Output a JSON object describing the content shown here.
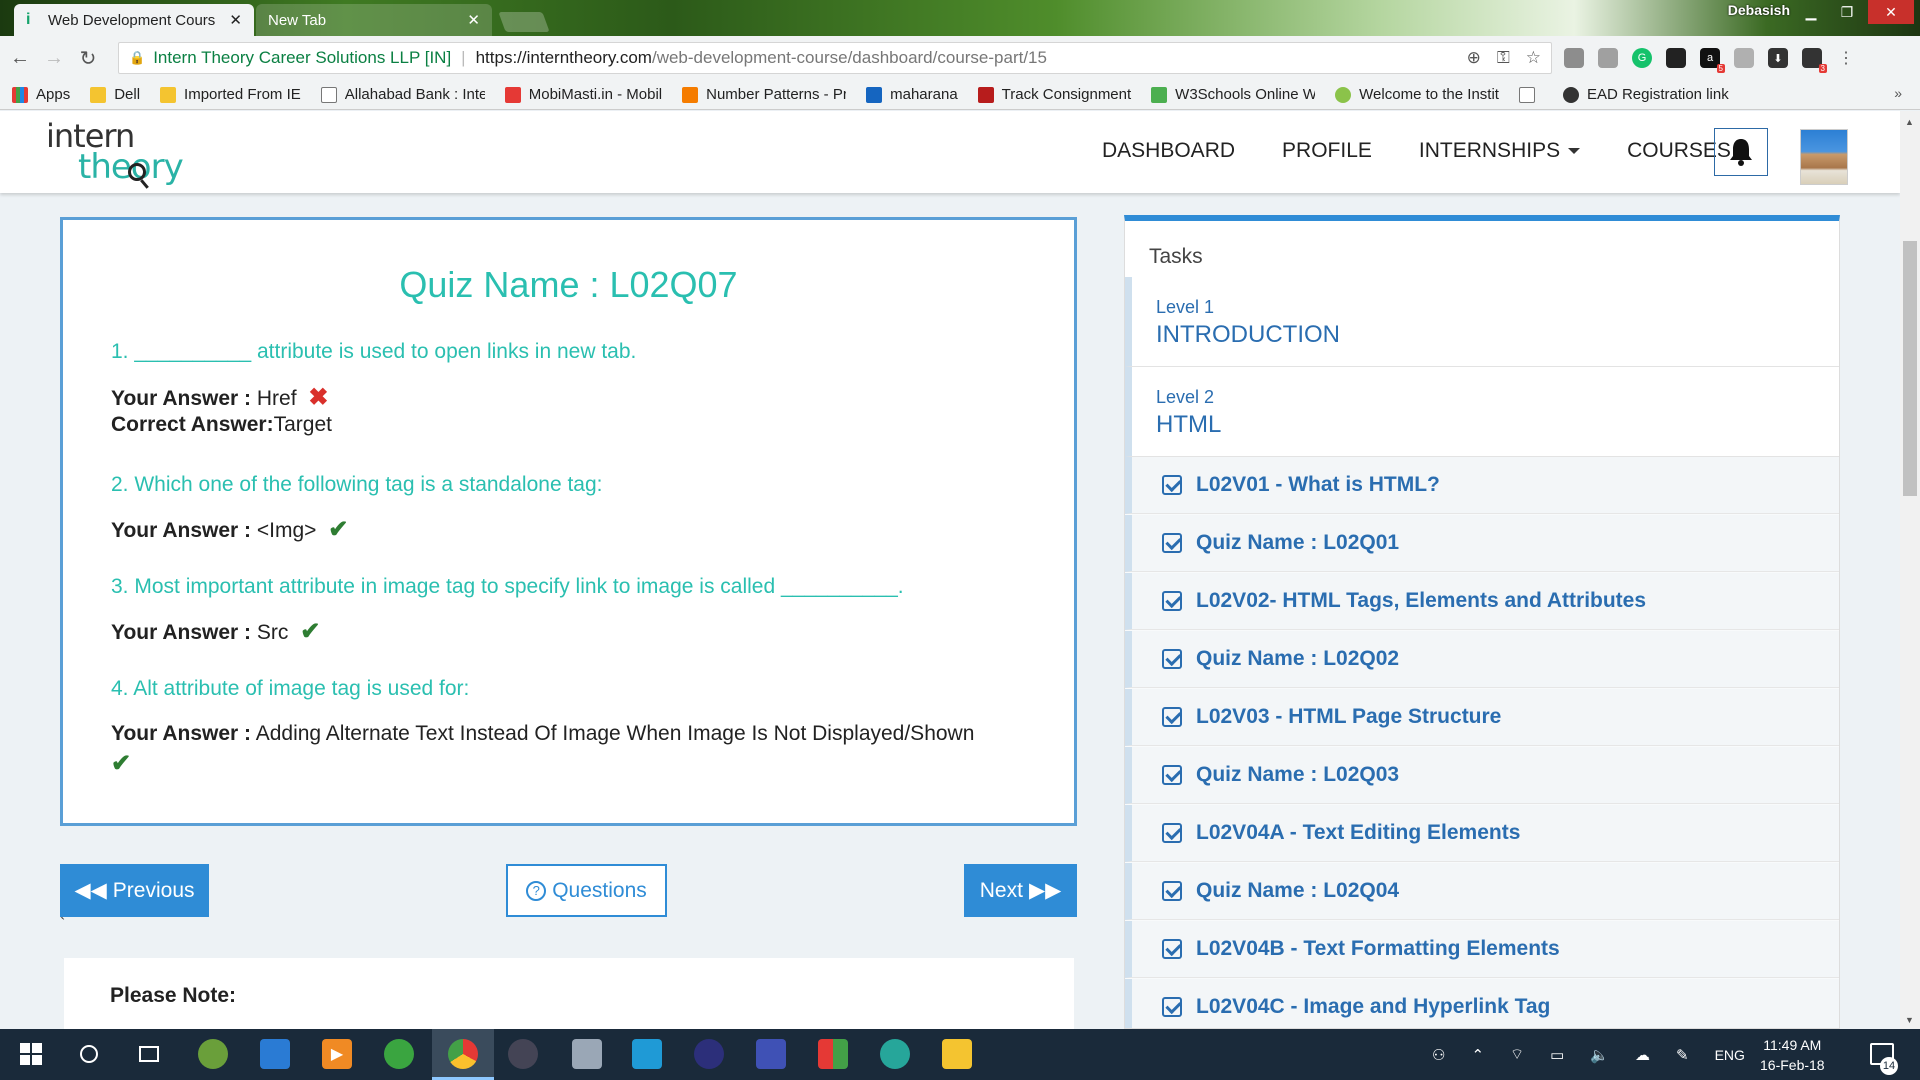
{
  "browser": {
    "tabs": [
      {
        "title": "Web Development Cours",
        "active": true
      },
      {
        "title": "New Tab",
        "active": false
      }
    ],
    "user": "Debasish",
    "site_identity": "Intern Theory Career Solutions LLP [IN]",
    "url_host": "https://interntheory.com",
    "url_path": "/web-development-course/dashboard/course-part/15",
    "extension_badges": [
      "5",
      "3"
    ],
    "bookmarks": [
      {
        "label": "Apps",
        "icon": "apps-grid-icon"
      },
      {
        "label": "Dell",
        "icon": "folder-icon"
      },
      {
        "label": "Imported From IE",
        "icon": "folder-icon"
      },
      {
        "label": "Allahabad Bank : Inte",
        "icon": "page-icon"
      },
      {
        "label": "MobiMasti.in - Mobil",
        "icon": "mobimasti-icon"
      },
      {
        "label": "Number Patterns - Pr",
        "icon": "blogger-icon"
      },
      {
        "label": "maharana",
        "icon": "x-logo-icon"
      },
      {
        "label": "Track Consignment",
        "icon": "courier-icon"
      },
      {
        "label": "W3Schools Online W",
        "icon": "w3schools-icon"
      },
      {
        "label": "Welcome to the Instit",
        "icon": "institute-icon"
      },
      {
        "label": "",
        "icon": "page-icon"
      },
      {
        "label": "EAD Registration link",
        "icon": "gear-icon"
      }
    ],
    "bookmarks_overflow": "»"
  },
  "site": {
    "logo_top": "intern",
    "logo_bottom": "theory",
    "nav": {
      "dashboard": "DASHBOARD",
      "profile": "PROFILE",
      "internships": "INTERNSHIPS",
      "courses": "COURSES"
    }
  },
  "quiz": {
    "title": "Quiz Name : L02Q07",
    "questions": [
      {
        "text": "1. __________ attribute is used to open links in new tab.",
        "your_answer_label": "Your Answer :",
        "your_answer": "Href",
        "result": "wrong",
        "correct_label": "Correct Answer:",
        "correct_answer": "Target"
      },
      {
        "text": "2. Which one of the following tag is a standalone tag:",
        "your_answer_label": "Your Answer :",
        "your_answer": "<Img>",
        "result": "correct"
      },
      {
        "text": "3. Most important attribute in image tag to specify link to image is called __________.",
        "your_answer_label": "Your Answer :",
        "your_answer": "Src",
        "result": "correct"
      },
      {
        "text": "4. Alt attribute of image tag is used for:",
        "your_answer_label": "Your Answer :",
        "your_answer": "Adding Alternate Text Instead Of Image When Image Is Not Displayed/Shown",
        "result": "correct"
      }
    ],
    "buttons": {
      "previous": "Previous",
      "questions": "Questions",
      "next": "Next"
    },
    "stray_mark": "`",
    "note_title": "Please Note:"
  },
  "tasks": {
    "heading": "Tasks",
    "levels": [
      {
        "level": "Level 1",
        "name": "INTRODUCTION"
      },
      {
        "level": "Level 2",
        "name": "HTML"
      }
    ],
    "items": [
      "L02V01 - What is HTML?",
      "Quiz Name : L02Q01",
      "L02V02- HTML Tags, Elements and Attributes",
      "Quiz Name : L02Q02",
      "L02V03 - HTML Page Structure",
      "Quiz Name : L02Q03",
      "L02V04A - Text Editing Elements",
      "Quiz Name : L02Q04",
      "L02V04B - Text Formatting Elements",
      "L02V04C - Image and Hyperlink Tag"
    ]
  },
  "taskbar": {
    "language": "ENG",
    "time": "11:49 AM",
    "date": "16-Feb-18",
    "notification_count": "14"
  },
  "colors": {
    "quiz_teal": "#2abfb0",
    "primary_blue": "#2f8cd6",
    "task_blue": "#2a6db0",
    "wrong_red": "#d9302b",
    "right_green": "#2e7d32"
  }
}
